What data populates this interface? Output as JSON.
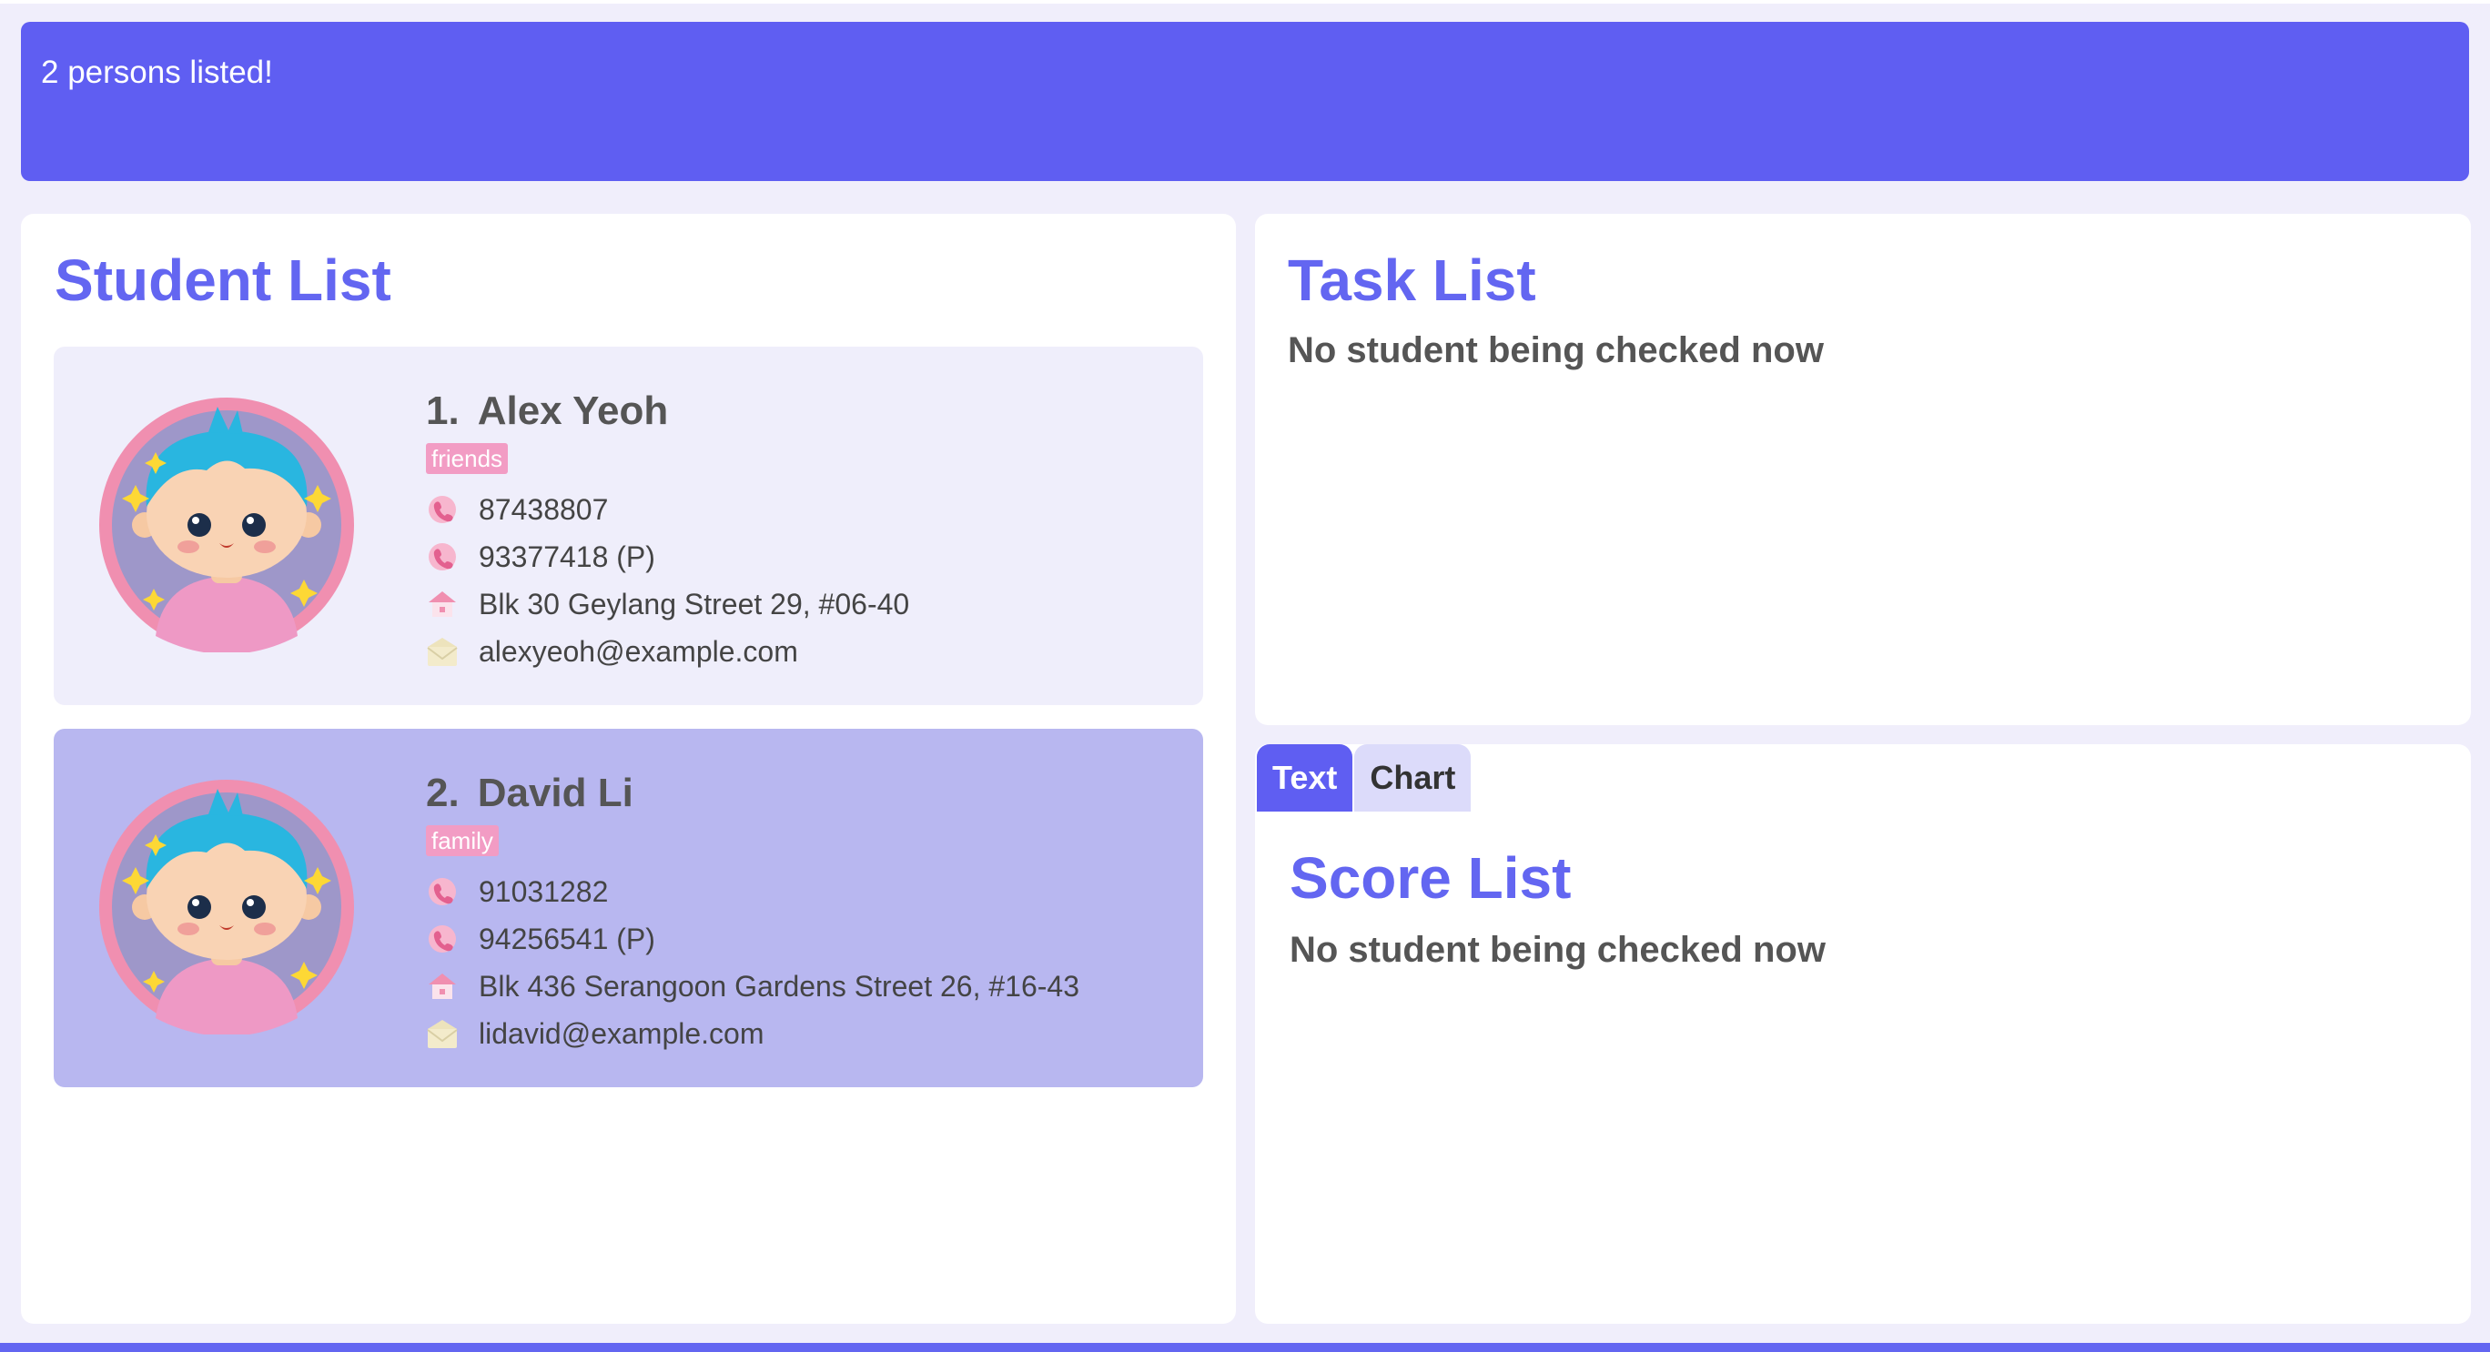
{
  "result": {
    "message": "2 persons listed!"
  },
  "student_panel": {
    "title": "Student List",
    "students": [
      {
        "index": "1.",
        "name": "Alex Yeoh",
        "tag": "friends",
        "phone": "87438807",
        "parent_phone": "93377418 (P)",
        "address": "Blk 30 Geylang Street 29, #06-40",
        "email": "alexyeoh@example.com"
      },
      {
        "index": "2.",
        "name": "David Li",
        "tag": "family",
        "phone": "91031282",
        "parent_phone": "94256541 (P)",
        "address": "Blk 436 Serangoon Gardens Street 26, #16-43",
        "email": "lidavid@example.com"
      }
    ]
  },
  "task_panel": {
    "title": "Task List",
    "empty_message": "No student being checked now"
  },
  "score_panel": {
    "tabs": [
      {
        "label": "Text",
        "active": true
      },
      {
        "label": "Chart",
        "active": false
      }
    ],
    "title": "Score List",
    "empty_message": "No student being checked now"
  },
  "colors": {
    "accent": "#6366F1",
    "result_bg": "#5F5EF2",
    "background": "#F0EEFB",
    "card": "#EFEEFB",
    "card_selected": "#B8B7F0",
    "tag": "#F29CC4"
  },
  "icons": {
    "phone": "phone-icon",
    "address": "home-icon",
    "email": "email-envelope-icon",
    "avatar": "student-avatar-icon"
  }
}
